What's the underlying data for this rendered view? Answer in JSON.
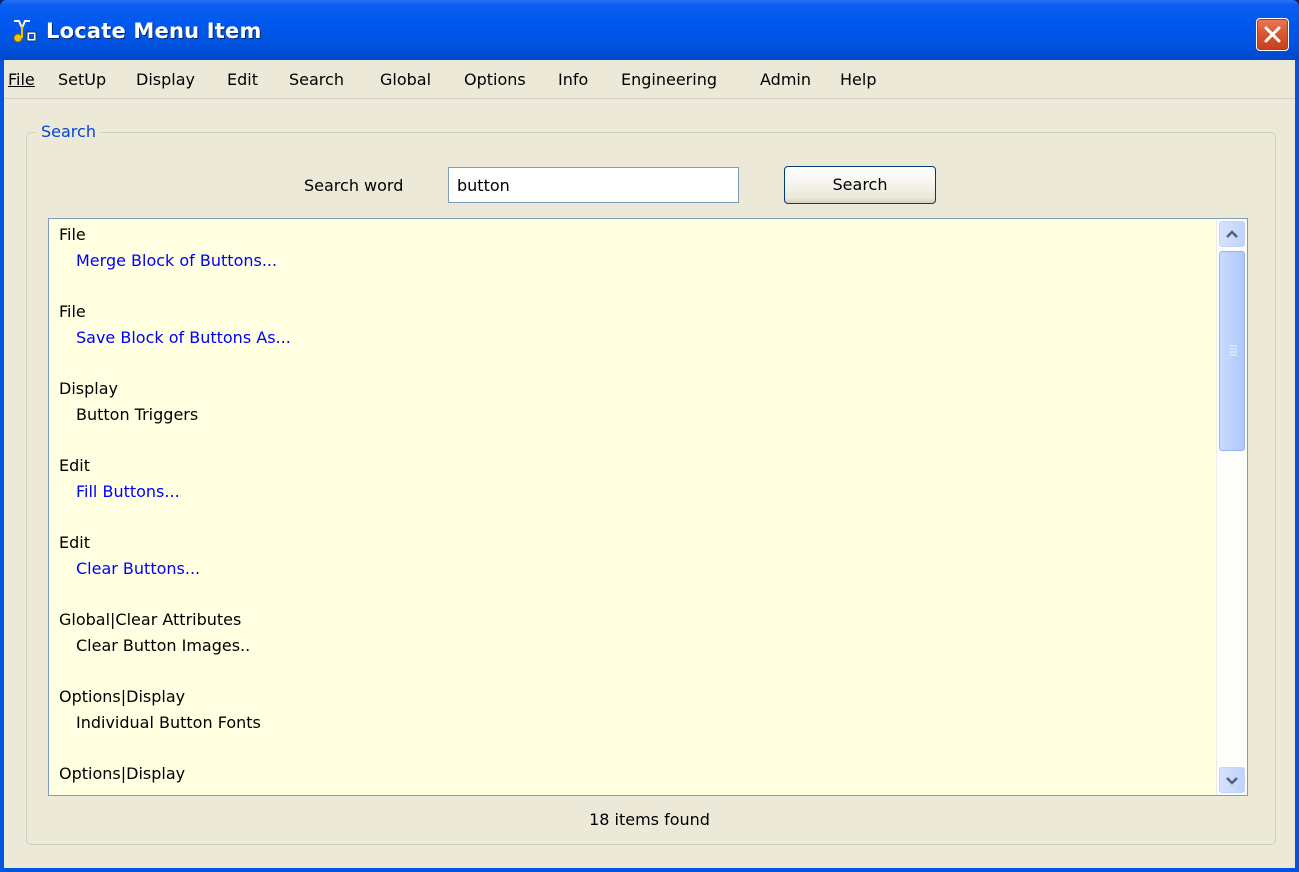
{
  "window": {
    "title": "Locate Menu Item",
    "icon": "app-music-icon",
    "close_icon": "close-icon"
  },
  "menubar": {
    "items": [
      {
        "label": "File",
        "mnemonic": "F"
      },
      {
        "label": "SetUp",
        "mnemonic": "S"
      },
      {
        "label": "Display",
        "mnemonic": "D"
      },
      {
        "label": "Edit",
        "mnemonic": "E"
      },
      {
        "label": "Search",
        "mnemonic": "a"
      },
      {
        "label": "Global",
        "mnemonic": "G"
      },
      {
        "label": "Options",
        "mnemonic": "O"
      },
      {
        "label": "Info",
        "mnemonic": "I"
      },
      {
        "label": "Engineering",
        "mnemonic": "n"
      },
      {
        "label": "Admin",
        "mnemonic": "m"
      },
      {
        "label": "Help",
        "mnemonic": "H"
      }
    ]
  },
  "search": {
    "group_label": "Search",
    "word_label": "Search word",
    "word_value": "button",
    "button_label": "Search"
  },
  "results": {
    "entries": [
      {
        "group": "File",
        "item": "Merge Block of Buttons...",
        "style": "link"
      },
      {
        "group": "File",
        "item": "Save Block of Buttons As...",
        "style": "link"
      },
      {
        "group": "Display",
        "item": "Button Triggers",
        "style": "plain"
      },
      {
        "group": "Edit",
        "item": "Fill Buttons...",
        "style": "link"
      },
      {
        "group": "Edit",
        "item": "Clear Buttons...",
        "style": "link"
      },
      {
        "group": "Global|Clear Attributes",
        "item": "Clear Button Images..",
        "style": "plain"
      },
      {
        "group": "Options|Display",
        "item": "Individual Button Fonts",
        "style": "plain"
      },
      {
        "group": "Options|Display",
        "item": "",
        "style": "plain"
      }
    ],
    "status": "18 items found"
  },
  "colors": {
    "titlebar": "#0054e3",
    "client": "#ece9d8",
    "results_bg": "#ffffe1",
    "link": "#0000ff",
    "group_label": "#0046d5"
  }
}
